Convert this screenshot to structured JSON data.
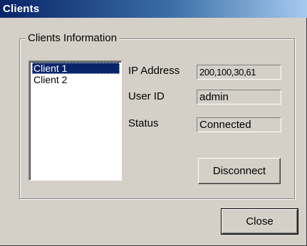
{
  "window": {
    "title": "Clients"
  },
  "group": {
    "label": "Clients Information"
  },
  "clients": [
    {
      "label": "Client 1",
      "selected": true
    },
    {
      "label": "Client 2",
      "selected": false
    }
  ],
  "fields": {
    "ip_label": "IP Address",
    "ip_value": "200,100,30,61",
    "user_label": "User ID",
    "user_value": "admin",
    "status_label": "Status",
    "status_value": "Connected"
  },
  "buttons": {
    "disconnect": "Disconnect",
    "close": "Close"
  },
  "colors": {
    "title_start": "#0a246a",
    "title_end": "#a6caf0",
    "face": "#d4d0c8",
    "selection": "#0a246a"
  }
}
